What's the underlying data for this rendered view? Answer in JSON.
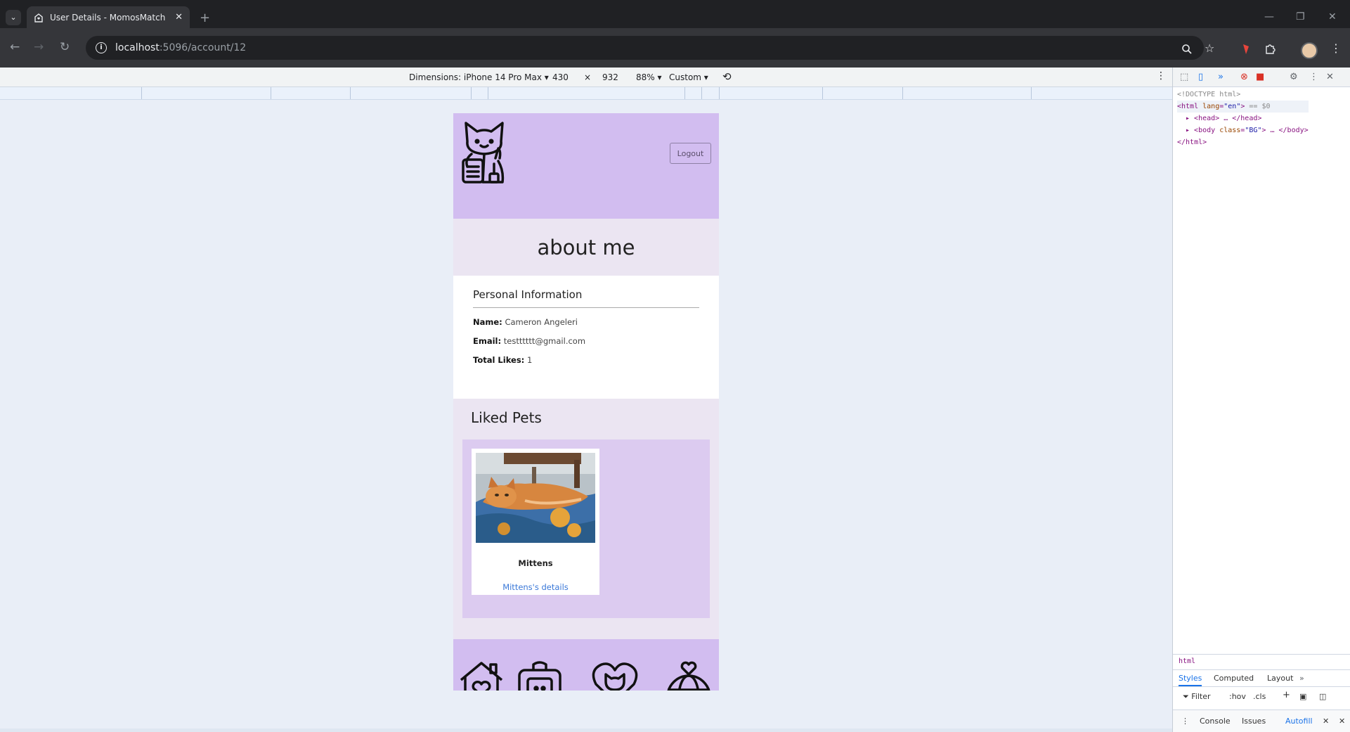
{
  "browser": {
    "tab_title": "User Details - MomosMatch",
    "url_host": "localhost",
    "url_path": ":5096/account/12"
  },
  "device_toolbar": {
    "dimensions_label": "Dimensions: iPhone 14 Pro Max",
    "width": "430",
    "times": "×",
    "height": "932",
    "zoom": "88%",
    "throttle": "Custom"
  },
  "page": {
    "logout_label": "Logout",
    "about_title": "about me",
    "personal_info": {
      "heading": "Personal Information",
      "name_label": "Name:",
      "name_value": "Cameron Angeleri",
      "email_label": "Email:",
      "email_value": "testttttt@gmail.com",
      "likes_label": "Total Likes:",
      "likes_value": "1"
    },
    "liked_pets": {
      "heading": "Liked Pets",
      "pets": [
        {
          "name": "Mittens",
          "link": "Mittens's details"
        }
      ]
    },
    "footer_icons": [
      "home-heart-icon",
      "pet-carrier-icon",
      "cat-heart-icon",
      "globe-heart-icon"
    ],
    "header_icon": "cat-mascot-logo-icon"
  },
  "devtools": {
    "dom": {
      "doctype": "<!DOCTYPE html>",
      "html_open_tag": "<html",
      "html_attr": "lang",
      "html_attr_value": "\"en\"",
      "html_suffix": "== $0",
      "head_line": "<head> … </head>",
      "body_open": "<body",
      "body_attr": "class",
      "body_attr_value": "\"BG\"",
      "body_close": "> … </body>",
      "html_close": "</html>"
    },
    "breadcrumb": "html",
    "styles_tabs": [
      "Styles",
      "Computed",
      "Layout"
    ],
    "filter_label": "Filter",
    "hov": ":hov",
    "cls": ".cls",
    "drawer_tabs": [
      "Console",
      "Issues",
      "Autofill"
    ]
  }
}
